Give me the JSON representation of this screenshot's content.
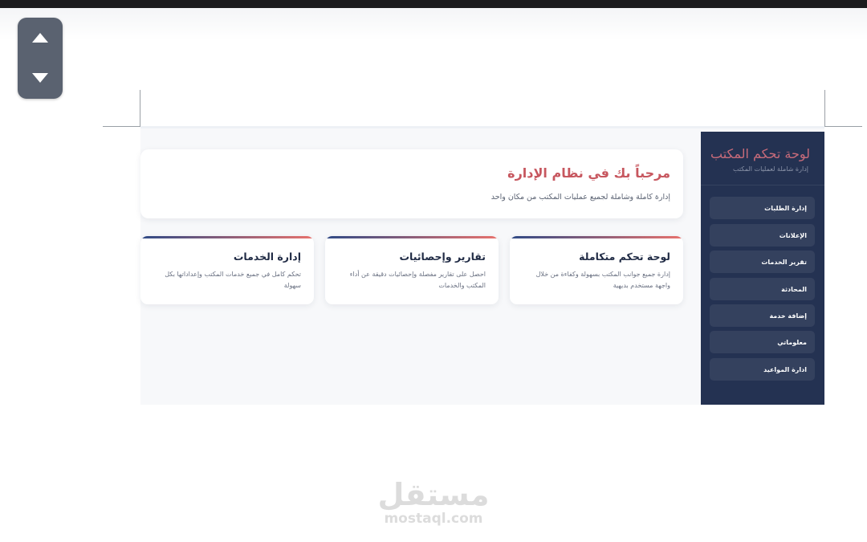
{
  "sidebar": {
    "title": "لوحة تحكم المكتب",
    "subtitle": "إدارة شاملة لعمليات المكتب",
    "items": [
      {
        "label": "إدارة الطلبات"
      },
      {
        "label": "الإعلانات"
      },
      {
        "label": "تقرير الخدمات"
      },
      {
        "label": "المحادثة"
      },
      {
        "label": "إضافة خدمة"
      },
      {
        "label": "معلوماتي"
      },
      {
        "label": "ادارة المواعيد"
      }
    ]
  },
  "welcome": {
    "title": "مرحباً بك في نظام الإدارة",
    "subtitle": "إدارة كاملة وشاملة لجميع عمليات المكتب من مكان واحد"
  },
  "cards": [
    {
      "title": "لوحة تحكم متكاملة",
      "desc": "إدارة جميع جوانب المكتب بسهولة وكفاءة من خلال واجهة مستخدم بديهية"
    },
    {
      "title": "تقارير وإحصائيات",
      "desc": "احصل على تقارير مفصلة وإحصائيات دقيقة عن أداء المكتب والخدمات"
    },
    {
      "title": "إدارة الخدمات",
      "desc": "تحكم كامل في جميع خدمات المكتب وإعداداتها بكل سهولة"
    }
  ],
  "watermark": {
    "arabic": "مستقل",
    "latin": "mostaql.com"
  },
  "icons": {
    "scroll_up": "triangle-up-icon",
    "scroll_down": "triangle-down-icon"
  },
  "colors": {
    "sidebar_bg": "#243252",
    "accent_red": "#c7575f",
    "gradient_start": "#2f4a86",
    "gradient_end": "#e8726d"
  }
}
